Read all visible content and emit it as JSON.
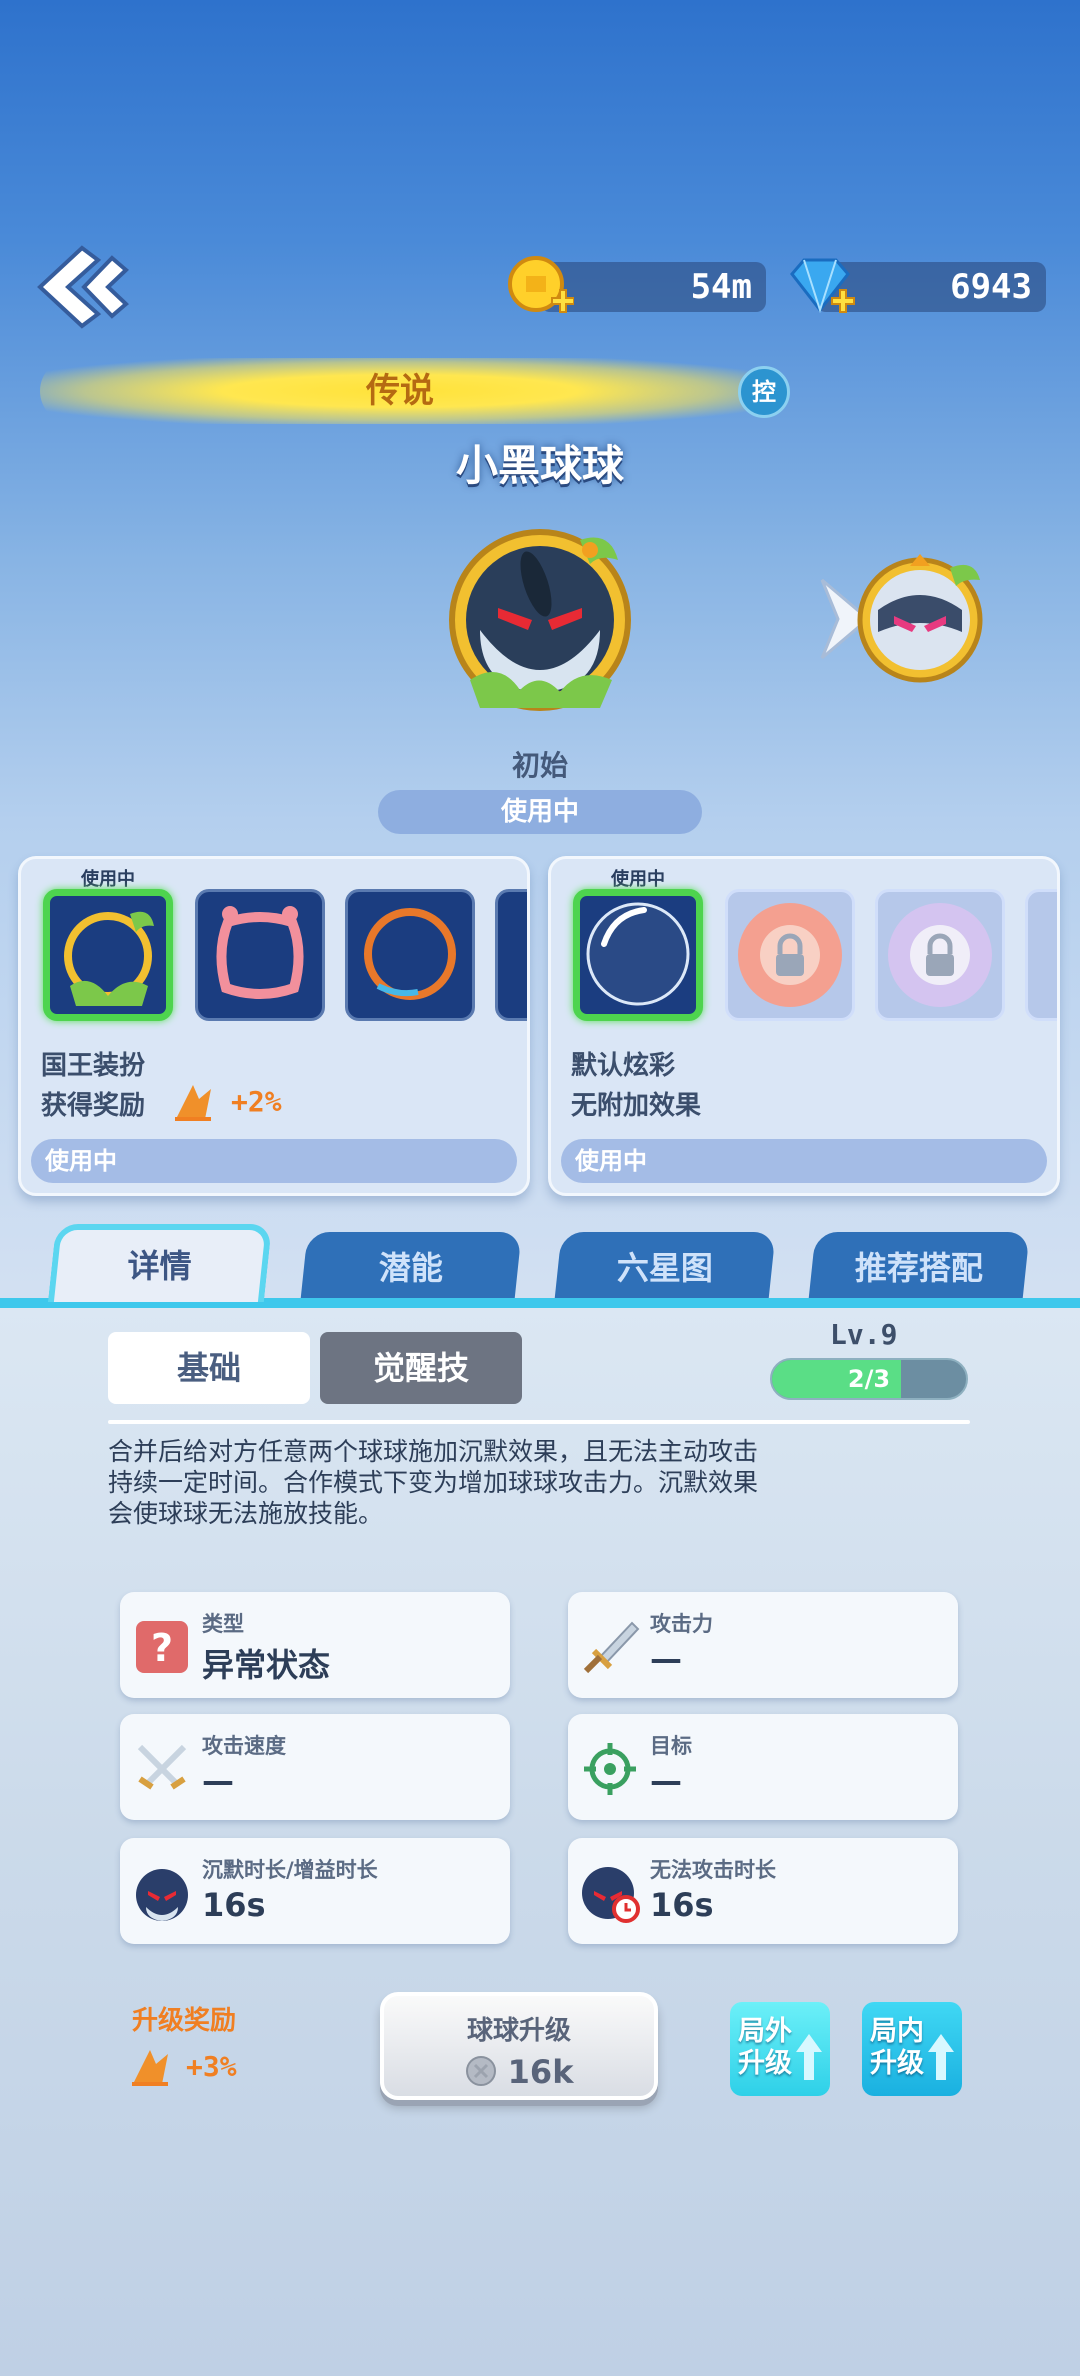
{
  "currency": {
    "gold": "54m",
    "gems": "6943"
  },
  "character": {
    "rarity": "传说",
    "control_badge": "控",
    "name": "小黑球球",
    "stage": "初始",
    "status": "使用中"
  },
  "skin_card": {
    "in_use_tag": "使用中",
    "title": "国王装扮",
    "reward_label": "获得奖励",
    "reward_value": "+2%",
    "footer": "使用中"
  },
  "effect_card": {
    "in_use_tag": "使用中",
    "title": "默认炫彩",
    "subtitle": "无附加效果",
    "footer": "使用中"
  },
  "tabs": [
    "详情",
    "潜能",
    "六星图",
    "推荐搭配"
  ],
  "subtabs": [
    "基础",
    "觉醒技"
  ],
  "level": {
    "label": "Lv.9",
    "progress": "2/3",
    "progress_value": 0.667
  },
  "description": [
    "合并后给对方任意两个球球施加沉默效果，且无法主动攻击",
    "持续一定时间。合作模式下变为增加球球攻击力。沉默效果",
    "会使球球无法施放技能。"
  ],
  "stats": [
    {
      "key": "类型",
      "value": "异常状态",
      "icon": "question-icon"
    },
    {
      "key": "攻击力",
      "value": "—",
      "icon": "sword-icon"
    },
    {
      "key": "攻击速度",
      "value": "—",
      "icon": "crossed-swords-icon"
    },
    {
      "key": "目标",
      "value": "—",
      "icon": "target-icon"
    },
    {
      "key": "沉默时长/增益时长",
      "value": "16s",
      "icon": "ball-icon"
    },
    {
      "key": "无法攻击时长",
      "value": "16s",
      "icon": "ball-timer-icon"
    }
  ],
  "upgrade": {
    "reward_label": "升级奖励",
    "reward_value": "+3%",
    "button_label": "球球升级",
    "button_cost": "16k",
    "outside_label": [
      "局外",
      "升级"
    ],
    "inside_label": [
      "局内",
      "升级"
    ]
  },
  "colors": {
    "accent": "#3ec8ec",
    "reward": "#f07f22",
    "selected": "#4ed44e"
  }
}
